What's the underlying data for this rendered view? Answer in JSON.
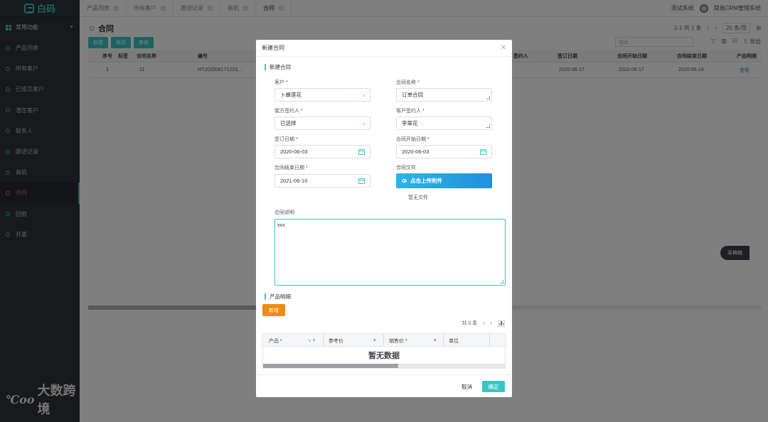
{
  "sidebar": {
    "logo": "白码",
    "group": "常用功能",
    "items": [
      {
        "label": "产品列表"
      },
      {
        "label": "所有客户"
      },
      {
        "label": "已成交客户"
      },
      {
        "label": "潜在客户"
      },
      {
        "label": "联系人"
      },
      {
        "label": "跟进记录"
      },
      {
        "label": "商机"
      },
      {
        "label": "合同"
      },
      {
        "label": "回款"
      },
      {
        "label": "开票"
      }
    ],
    "watermark": "大数跨境"
  },
  "topbar": {
    "tabs": [
      {
        "label": "产品列表"
      },
      {
        "label": "所有客户"
      },
      {
        "label": "跟进记录"
      },
      {
        "label": "商机"
      },
      {
        "label": "合同"
      }
    ],
    "test_system": "测试系统",
    "app_name": "简易CRM管理系统"
  },
  "page": {
    "title": "合同",
    "pager": {
      "range": "1-1 共 1 条",
      "per_page": "20 条/页"
    },
    "actions": {
      "new": "新建",
      "edit": "修改",
      "audit": "审核"
    },
    "search_placeholder": "搜索...",
    "export": "导出",
    "table": {
      "headers": [
        "序号",
        "标签",
        "合同名称",
        "编号",
        "签约人",
        "签订日期",
        "合同开始日期",
        "合同结束日期",
        "产品明细"
      ],
      "row": {
        "index": "1",
        "name": "11",
        "number": "HT202006171223...",
        "signed": "2020-06-17",
        "start": "2020-06-17",
        "end": "2020-06-19",
        "view": "查看"
      }
    },
    "float_button": "草稿箱"
  },
  "modal": {
    "title": "新建合同",
    "section_contract": "新建合同",
    "fields": {
      "customer_label": "客户 *",
      "customer_value": "卜蜂莲花",
      "contract_name_label": "合同名称 *",
      "contract_name_value": "订单合同",
      "our_signer_label": "我方签约人 *",
      "our_signer_value": "已选择",
      "customer_signer_label": "客户签约人 *",
      "customer_signer_value": "李翠花",
      "sign_date_label": "签订日期 *",
      "sign_date_value": "2020-06-03",
      "start_date_label": "合同开始日期 *",
      "start_date_value": "2020-06-03",
      "end_date_label": "合同结束日期 *",
      "end_date_value": "2021-06-10",
      "file_label": "合同文件",
      "upload_button": "点击上传附件",
      "no_file": "暂无文件",
      "desc_label": "合同说明",
      "desc_value": "xxx"
    },
    "section_products": "产品明细",
    "add_button": "新增",
    "product_pager": "共 0 条",
    "product_headers": [
      "产品 *",
      "参考价",
      "销售价 *",
      "单位"
    ],
    "empty_text": "暂无数据",
    "cancel": "取消",
    "confirm": "确定"
  },
  "colors": {
    "accent": "#3bc5c6",
    "orange": "#f08a12",
    "upload": "#1f90de"
  }
}
